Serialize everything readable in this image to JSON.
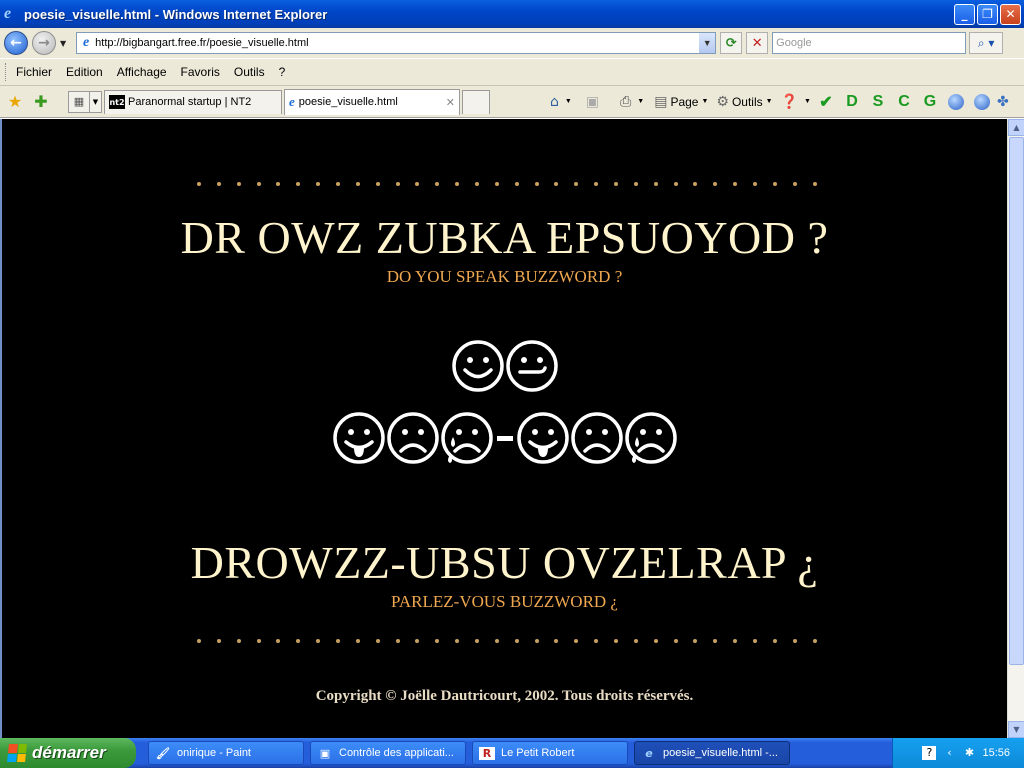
{
  "window": {
    "title": "poesie_visuelle.html - Windows Internet Explorer",
    "minimize_icon": "minimize-icon",
    "maximize_icon": "restore-icon",
    "close_icon": "close-icon"
  },
  "address_bar": {
    "url": "http://bigbangart.free.fr/poesie_visuelle.html",
    "search_placeholder": "Google"
  },
  "menu": {
    "items": [
      "Fichier",
      "Edition",
      "Affichage",
      "Favoris",
      "Outils",
      "?"
    ]
  },
  "tabs": [
    {
      "label": "Paranormal startup | NT2",
      "favicon": "NT2"
    },
    {
      "label": "poesie_visuelle.html",
      "favicon": "ie",
      "active": true
    }
  ],
  "command_bar": {
    "page_label": "Page",
    "tools_label": "Outils",
    "letters": [
      "D",
      "S",
      "C",
      "G"
    ]
  },
  "page": {
    "line1": "DR OWZ ZUBKA EPSUOYOD ?",
    "line1_translation": "DO YOU SPEAK BUZZWORD ?",
    "line2": "DROWZZ-UBSU OVZELRAP ¿",
    "line2_translation": "PARLEZ-VOUS BUZZWORD ¿",
    "copyright": "Copyright © Joëlle Dautricourt, 2002. Tous droits réservés.",
    "faces_row1": [
      "smile",
      "neutral-smile"
    ],
    "faces_row2": [
      "tongue",
      "frown",
      "cry",
      "dash",
      "tongue",
      "frown",
      "cry"
    ]
  },
  "taskbar": {
    "start_label": "démarrer",
    "buttons": [
      {
        "label": "onirique - Paint",
        "icon": "paint-icon"
      },
      {
        "label": "Contrôle des applicati...",
        "icon": "app-control-icon"
      },
      {
        "label": "Le Petit Robert",
        "icon": "robert-icon"
      },
      {
        "label": "poesie_visuelle.html -...",
        "icon": "ie-icon",
        "active": true
      }
    ],
    "clock": "15:56"
  },
  "colors": {
    "page_bg": "#000000",
    "headline": "#fff4cc",
    "translation": "#f0a850",
    "xp_blue": "#245edb"
  }
}
